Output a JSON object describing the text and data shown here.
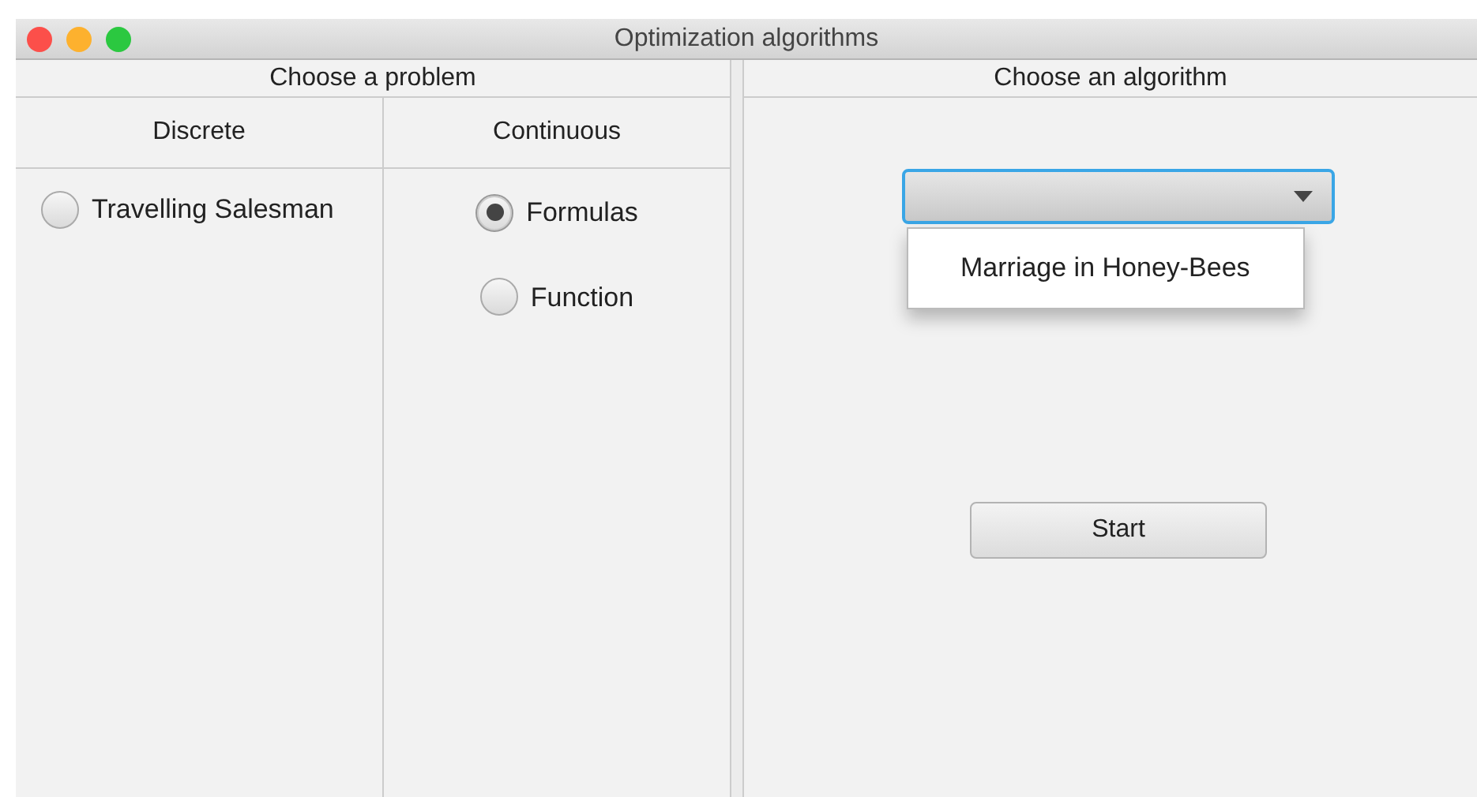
{
  "window": {
    "title": "Optimization algorithms"
  },
  "problem_panel": {
    "title": "Choose a problem",
    "columns": [
      {
        "heading": "Discrete",
        "options": [
          {
            "label": "Travelling Salesman",
            "selected": false
          }
        ]
      },
      {
        "heading": "Continuous",
        "options": [
          {
            "label": "Formulas",
            "selected": true
          },
          {
            "label": "Function",
            "selected": false
          }
        ]
      }
    ]
  },
  "algorithm_panel": {
    "title": "Choose an algorithm",
    "dropdown": {
      "focused": true,
      "expanded": true,
      "options": [
        "Marriage in Honey-Bees"
      ]
    },
    "buttons": [
      "Start"
    ]
  }
}
